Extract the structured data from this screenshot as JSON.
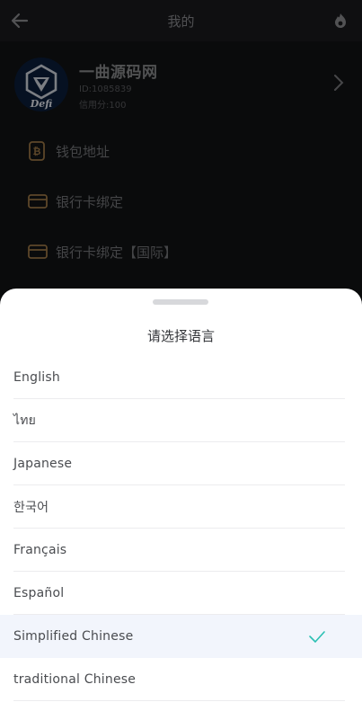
{
  "header": {
    "title": "我的",
    "back_icon": "arrow-left-icon",
    "right_icon": "flame-icon"
  },
  "profile": {
    "avatar_label": "Defi",
    "name": "一曲源码网",
    "uid": "ID:1085839",
    "credit": "信用分:100"
  },
  "menu": {
    "items": [
      {
        "label": "钱包地址",
        "icon": "bitcoin-doc-icon"
      },
      {
        "label": "银行卡绑定",
        "icon": "card-icon"
      },
      {
        "label": "银行卡绑定【国际】",
        "icon": "card-icon"
      }
    ]
  },
  "sheet": {
    "title": "请选择语言",
    "languages": [
      {
        "label": "English",
        "selected": false
      },
      {
        "label": "ไทย",
        "selected": false
      },
      {
        "label": "Japanese",
        "selected": false
      },
      {
        "label": "한국어",
        "selected": false
      },
      {
        "label": "Français",
        "selected": false
      },
      {
        "label": "Español",
        "selected": false
      },
      {
        "label": "Simplified Chinese",
        "selected": true
      },
      {
        "label": "traditional Chinese",
        "selected": false
      }
    ]
  },
  "colors": {
    "accent_gold": "#a07a48",
    "check": "#2bc0b3",
    "selected_bg": "#f2f5fc"
  }
}
